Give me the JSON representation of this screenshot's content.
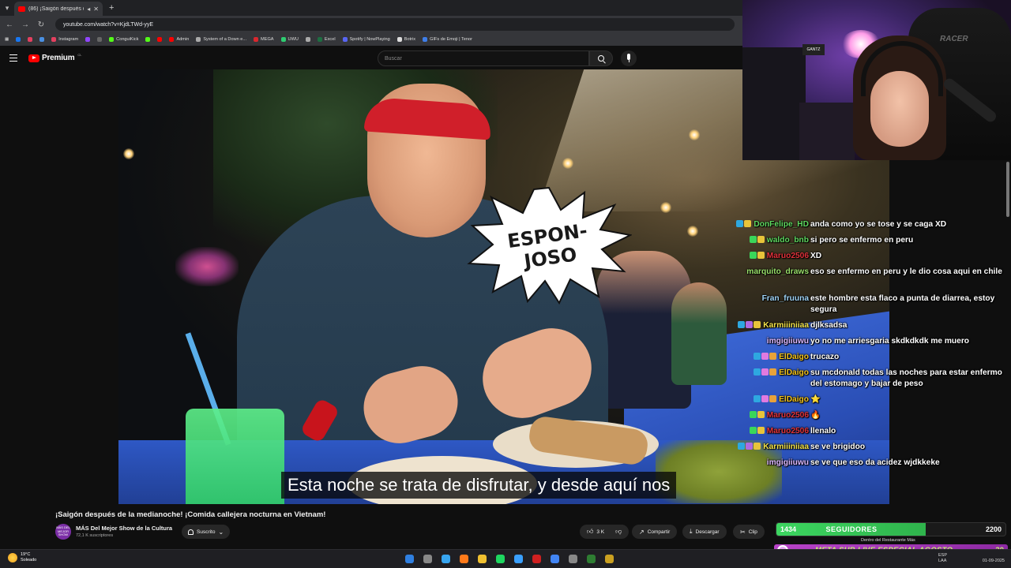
{
  "browser": {
    "tab_title": "(86) ¡Saigón después de la m",
    "url": "youtube.com/watch?v=KjdLTWd-yyE",
    "bookmarks": [
      {
        "label": "",
        "color": "#1877f2"
      },
      {
        "label": "",
        "color": "#e4405f"
      },
      {
        "label": "",
        "color": "#4a90e2"
      },
      {
        "label": "Instagram",
        "color": "#e4405f"
      },
      {
        "label": "",
        "color": "#9146ff"
      },
      {
        "label": "",
        "color": "#666666"
      },
      {
        "label": "ConguiKick",
        "color": "#53fc18"
      },
      {
        "label": "",
        "color": "#53fc18"
      },
      {
        "label": "",
        "color": "#ff0000"
      },
      {
        "label": "Admin",
        "color": "#ff0000"
      },
      {
        "label": "System of a Down e...",
        "color": "#aaaaaa"
      },
      {
        "label": "MEGA",
        "color": "#d9272e"
      },
      {
        "label": "UWU",
        "color": "#2ecc71"
      },
      {
        "label": "",
        "color": "#aaaaaa"
      },
      {
        "label": "Excel",
        "color": "#1d6f42"
      },
      {
        "label": "Spotify | NowPlaying",
        "color": "#5865f2"
      },
      {
        "label": "Botrix",
        "color": "#dddddd"
      },
      {
        "label": "GIFs de Emoji | Tenor",
        "color": "#3f7ee8"
      }
    ]
  },
  "youtube": {
    "logo_text": "Premium",
    "logo_country": "CL",
    "search_placeholder": "Buscar"
  },
  "video": {
    "burst_text": "ESPON-\nJOSO",
    "subtitle": "Esta noche se trata de disfrutar, y desde aquí nos",
    "title": "¡Saigón después de la medianoche! ¡Comida callejera nocturna en Vietnam!",
    "channel_name": "MÁS Del Mejor Show de la Cultura",
    "channel_subs": "72,1 K suscriptores",
    "channel_avatar_text": "MÁS DEL MEJOR SHOW",
    "subscribe_label": "Suscrito",
    "likes": "3 K",
    "share_label": "Compartir",
    "download_label": "Descargar",
    "clip_label": "Clip"
  },
  "chat": [
    {
      "user": "DonFelipe_HD",
      "color": "#5fd85f",
      "text": "anda como yo se tose y se caga XD",
      "badges": [
        "#2ea8e0",
        "#e8c43a"
      ]
    },
    {
      "user": "waldo_bnb",
      "color": "#5fd85f",
      "text": "si pero se enfermo en peru",
      "badges": [
        "#3ad65a",
        "#e8c43a"
      ]
    },
    {
      "user": "Maruo2506",
      "color": "#e0323a",
      "text": "XD",
      "badges": [
        "#3ad65a",
        "#e8c43a"
      ]
    },
    {
      "user": "marquito_draws",
      "color": "#9ae06a",
      "text": "eso se enfermo en peru y le dio cosa aqui en chile",
      "badges": []
    },
    {
      "user": "Fran_fruuna",
      "color": "#9fd3f5",
      "text": "este hombre esta flaco a punta de diarrea, estoy segura",
      "badges": []
    },
    {
      "user": "Karmiiiniiaa",
      "color": "#f2e24a",
      "text": "djlksadsa",
      "badges": [
        "#2ea8e0",
        "#b06ae0",
        "#e8c43a"
      ]
    },
    {
      "user": "imgigiiuwu",
      "color": "#dcb8ff",
      "text": "yo no me arriesgaria skdkdkdk me muero",
      "badges": []
    },
    {
      "user": "ElDaigo",
      "color": "#f2c21a",
      "text": "trucazo",
      "badges": [
        "#2ea8e0",
        "#e07ae0",
        "#e8a23a"
      ]
    },
    {
      "user": "ElDaigo",
      "color": "#f2c21a",
      "text": "su mcdonald todas las noches para estar enfermo del estomago y bajar de peso",
      "badges": [
        "#2ea8e0",
        "#e07ae0",
        "#e8a23a"
      ]
    },
    {
      "user": "ElDaigo",
      "color": "#f2c21a",
      "text": "⭐",
      "badges": [
        "#2ea8e0",
        "#e07ae0",
        "#e8a23a"
      ]
    },
    {
      "user": "Maruo2506",
      "color": "#e0323a",
      "text": "🔥",
      "badges": [
        "#3ad65a",
        "#e8c43a"
      ]
    },
    {
      "user": "Maruo2506",
      "color": "#e0323a",
      "text": "llenalo",
      "badges": [
        "#3ad65a",
        "#e8c43a"
      ]
    },
    {
      "user": "Karmiiiniiaa",
      "color": "#f2e24a",
      "text": "se ve brigidoo",
      "badges": [
        "#2ea8e0",
        "#b06ae0",
        "#e8c43a"
      ]
    },
    {
      "user": "imgigiiuwu",
      "color": "#dcb8ff",
      "text": "se ve que eso da acidez wjdkkeke",
      "badges": []
    }
  ],
  "stream_overlay": {
    "followers_current": "1434",
    "followers_label": "SEGUIDORES",
    "followers_goal": "2200",
    "followers_progress": 0.652,
    "sub_goal_text": "META SUB LIVE ESPECIAL AGOSTO",
    "sub_goal_count": "30",
    "dentro_text": "Dentro del Restaurante Más"
  },
  "webcam": {
    "chair_brand": "RACER",
    "sign_text": "GANTZ"
  },
  "taskbar": {
    "weather_temp": "19°C",
    "weather_desc": "Soleado",
    "tray_lang": "ESP",
    "tray_layout": "LAA",
    "tray_date": "01-09-2025",
    "apps": [
      "#2f7fe0",
      "#888888",
      "#37a5f0",
      "#ff7a1a",
      "#f0c030",
      "#1ed760",
      "#3aa0ff",
      "#d02020",
      "#4285f4",
      "#888888",
      "#2e7d32",
      "#caa020"
    ]
  }
}
